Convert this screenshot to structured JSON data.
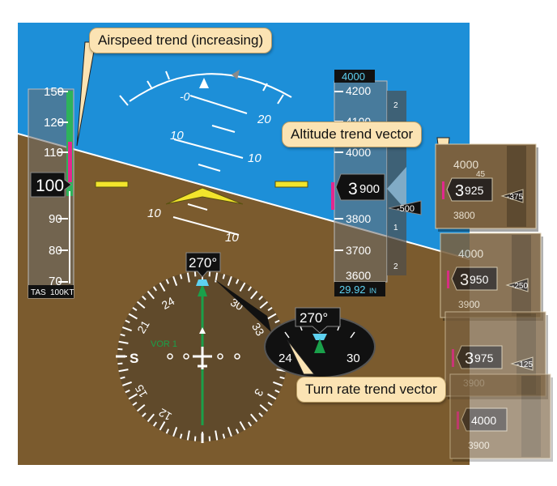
{
  "callouts": {
    "airspeed_trend": "Airspeed trend (increasing)",
    "altitude_trend": "Altitude trend vector",
    "turn_rate_trend": "Turn rate trend vector"
  },
  "airspeed": {
    "ticks": [
      "150",
      "120",
      "110",
      "90",
      "80",
      "70"
    ],
    "current": "100",
    "tas_label": "TAS",
    "tas_value": "100KT"
  },
  "attitude": {
    "pitch_labels_upper": [
      "20",
      "10",
      "10"
    ],
    "pitch_labels_lower": [
      "10",
      "10"
    ]
  },
  "altimeter": {
    "selected": "4000",
    "ticks": [
      "4200",
      "4100",
      "4000",
      "3800",
      "3700",
      "3600"
    ],
    "current_big": "3",
    "current_small": "900",
    "vsi_value": "-500",
    "baro": "29.92",
    "baro_unit": "IN",
    "vsi_scale": [
      "2",
      "1",
      "1",
      "2"
    ]
  },
  "heading": {
    "current": "270°",
    "nav_source": "VOR 1",
    "card_labels": [
      "24",
      "21",
      "S",
      "15",
      "12",
      "30",
      "33",
      "3"
    ]
  },
  "inset": {
    "heading": "270°",
    "labels": [
      "24",
      "30"
    ]
  },
  "altitude_frames": [
    {
      "ref": "4000",
      "big": "3",
      "small": "925",
      "vsi": "-375",
      "below": "3800",
      "tick": "45"
    },
    {
      "ref": "4000",
      "big": "3",
      "small": "950",
      "vsi": "-250",
      "below": "3900",
      "tick": ""
    },
    {
      "ref": "",
      "big": "3",
      "small": "975",
      "vsi": "-125",
      "below": "3900",
      "tick": ""
    },
    {
      "ref": "",
      "big": "",
      "small": "4000",
      "vsi": "",
      "below": "3900",
      "tick": ""
    }
  ],
  "colors": {
    "sky": "#1d8fd8",
    "ground": "#7b5b2e",
    "trend": "#e3288f",
    "symbol": "#f2e52c",
    "nav": "#1aa04a",
    "cyan": "#5ed1f0"
  }
}
